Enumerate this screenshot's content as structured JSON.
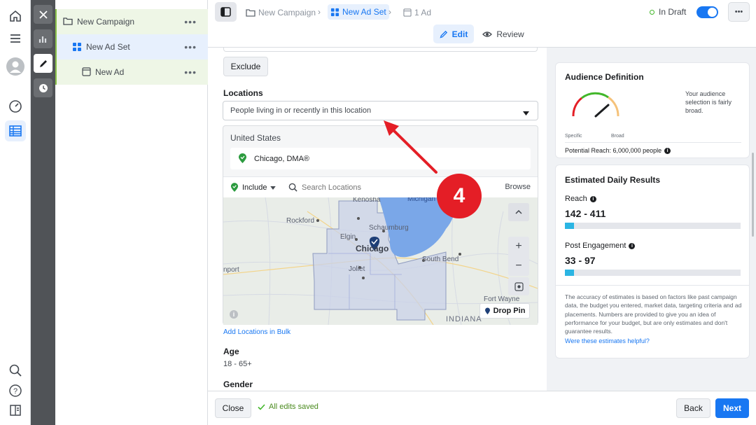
{
  "rail": {
    "items": [
      "home-icon",
      "menu-icon",
      "avatar",
      "dashboard-gauge-icon",
      "ads-table-icon"
    ],
    "bottom": [
      "search-icon",
      "help-icon",
      "panel-icon"
    ]
  },
  "tree": {
    "campaign": "New Campaign",
    "adset": "New Ad Set",
    "ad": "New Ad",
    "more": "•••"
  },
  "topbar": {
    "crumb_campaign": "New Campaign",
    "crumb_adset": "New Ad Set",
    "crumb_ad": "1 Ad",
    "status": "In Draft",
    "more": "•••",
    "edit_label": "Edit",
    "review_label": "Review"
  },
  "form": {
    "exclude_label": "Exclude",
    "locations_heading": "Locations",
    "location_select": "People living in or recently in this location",
    "country": "United States",
    "selected_location": "Chicago, DMA®",
    "include_label": "Include",
    "search_placeholder": "Search Locations",
    "browse_label": "Browse",
    "bulk_link": "Add Locations in Bulk",
    "age_heading": "Age",
    "age_value": "18 - 65+",
    "gender_heading": "Gender"
  },
  "map": {
    "labels": {
      "kenosha": "Kenosha",
      "michigan": "Michigan",
      "rockford": "Rockford",
      "schaumburg": "Schaumburg",
      "elgin": "Elgin",
      "chicago": "Chicago",
      "joliet": "Joliet",
      "south_bend": "South Bend",
      "naperville": "nport",
      "indiana": "INDIANA",
      "fort_wayne": "Fort Wayne"
    },
    "drop_pin": "Drop Pin",
    "zoom_in": "+",
    "zoom_out": "−"
  },
  "annotation": {
    "step": "4"
  },
  "audience": {
    "title": "Audience Definition",
    "specific": "Specific",
    "broad": "Broad",
    "note": "Your audience selection is fairly broad.",
    "potential_reach": "Potential Reach: 6,000,000 people"
  },
  "estimates": {
    "title": "Estimated Daily Results",
    "reach_label": "Reach",
    "reach_value": "142 - 411",
    "reach_fill": 0.05,
    "engagement_label": "Post Engagement",
    "engagement_value": "33 - 97",
    "engagement_fill": 0.05,
    "disclaimer": "The accuracy of estimates is based on factors like past campaign data, the budget you entered, market data, targeting criteria and ad placements. Numbers are provided to give you an idea of performance for your budget, but are only estimates and don't guarantee results.",
    "helpful_link": "Were these estimates helpful?"
  },
  "footer": {
    "close": "Close",
    "saved": "All edits saved",
    "back": "Back",
    "next": "Next"
  },
  "colors": {
    "accent": "#1877f2",
    "status_green": "#42b72a",
    "annotation_red": "#e41e26",
    "water": "#7aa7e8"
  }
}
